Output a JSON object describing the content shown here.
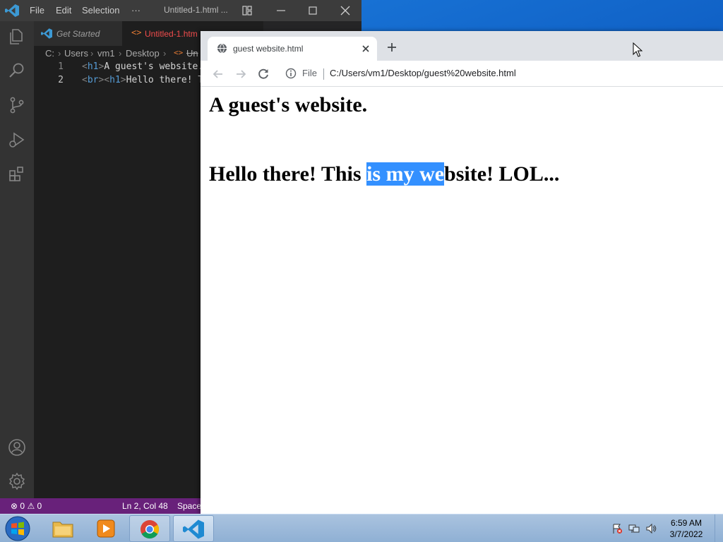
{
  "vscode": {
    "menu": [
      "File",
      "Edit",
      "Selection"
    ],
    "more": "···",
    "window_title": "Untitled-1.html ...",
    "tabs": {
      "get_started": "Get Started",
      "untitled": "Untitled-1.htm"
    },
    "breadcrumb": [
      "C:",
      "Users",
      "vm1",
      "Desktop",
      "Un"
    ],
    "lines": [
      {
        "num": "1",
        "open": "<",
        "tag1": "h1",
        "close": ">",
        "text": "A guest's website."
      },
      {
        "num": "2",
        "open": "<",
        "tag1": "br",
        "mid": "><",
        "tag2": "h1",
        "close": ">",
        "text": "Hello there! T"
      }
    ],
    "status": {
      "errors": "0",
      "warnings": "0",
      "position": "Ln 2, Col 48",
      "spaces": "Space"
    }
  },
  "chrome": {
    "tab_title": "guest website.html",
    "omnibox": {
      "scheme_label": "File",
      "url": "C:/Users/vm1/Desktop/guest%20website.html"
    }
  },
  "page": {
    "heading1": "A guest's website.",
    "heading2_before": "Hello there! This ",
    "heading2_selected": "is my we",
    "heading2_after": "bsite! LOL..."
  },
  "taskbar": {
    "time": "6:59 AM",
    "date": "3/7/2022"
  },
  "colors": {
    "vscode_status": "#68217a",
    "selection": "#3390ff",
    "vscode_accent": "#007acc"
  }
}
